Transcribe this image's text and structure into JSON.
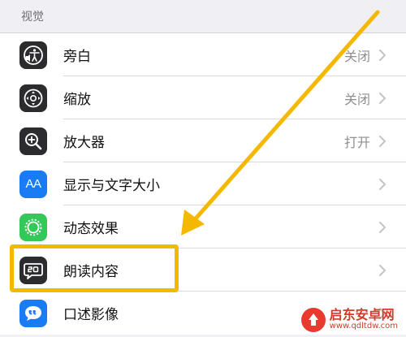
{
  "section": {
    "title": "视觉"
  },
  "rows": [
    {
      "label": "旁白",
      "value": "关闭",
      "icon": "voiceover-icon",
      "icon_color": "#2c2c2e"
    },
    {
      "label": "缩放",
      "value": "关闭",
      "icon": "zoom-icon",
      "icon_color": "#2c2c2e"
    },
    {
      "label": "放大器",
      "value": "打开",
      "icon": "magnifier-icon",
      "icon_color": "#2c2c2e"
    },
    {
      "label": "显示与文字大小",
      "value": "",
      "icon": "text-size-icon",
      "icon_color": "#1a7cf5"
    },
    {
      "label": "动态效果",
      "value": "",
      "icon": "motion-icon",
      "icon_color": "#34c759"
    },
    {
      "label": "朗读内容",
      "value": "",
      "icon": "spoken-content-icon",
      "icon_color": "#2c2c2e"
    },
    {
      "label": "口述影像",
      "value": "",
      "icon": "audio-descriptions-icon",
      "icon_color": "#1a7cf5"
    }
  ],
  "icons": {
    "text_size_glyph": "AA"
  },
  "annotation": {
    "color": "#f5b800"
  },
  "watermark": {
    "title": "启东安卓网",
    "url": "www.qdltdw.com"
  }
}
